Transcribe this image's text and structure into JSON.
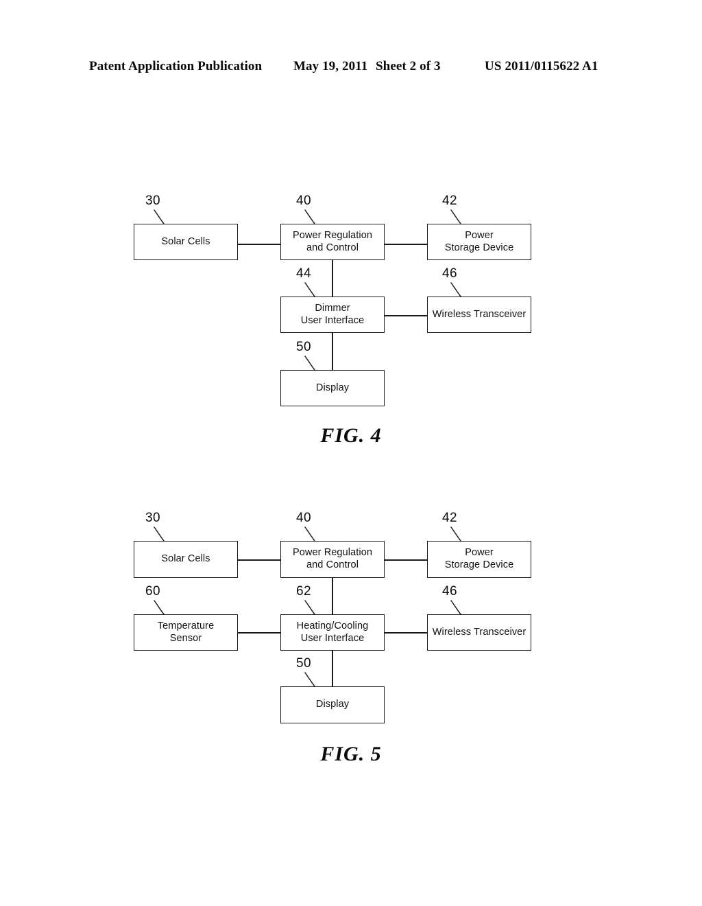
{
  "header": {
    "publication": "Patent Application Publication",
    "date": "May 19, 2011",
    "sheet": "Sheet 2 of 3",
    "patent_number": "US 2011/0115622 A1"
  },
  "figures": [
    {
      "id": "figure-4",
      "caption": "FIG. 4",
      "nodes": [
        {
          "ref": "30",
          "label": "Solar Cells"
        },
        {
          "ref": "40",
          "label": "Power Regulation\nand Control"
        },
        {
          "ref": "42",
          "label": "Power\nStorage Device"
        },
        {
          "ref": "44",
          "label": "Dimmer\nUser Interface"
        },
        {
          "ref": "46",
          "label": "Wireless Transceiver"
        },
        {
          "ref": "50",
          "label": "Display"
        }
      ]
    },
    {
      "id": "figure-5",
      "caption": "FIG. 5",
      "nodes": [
        {
          "ref": "30",
          "label": "Solar Cells"
        },
        {
          "ref": "40",
          "label": "Power Regulation\nand Control"
        },
        {
          "ref": "42",
          "label": "Power\nStorage Device"
        },
        {
          "ref": "60",
          "label": "Temperature\nSensor"
        },
        {
          "ref": "62",
          "label": "Heating/Cooling\nUser Interface"
        },
        {
          "ref": "46",
          "label": "Wireless Transceiver"
        },
        {
          "ref": "50",
          "label": "Display"
        }
      ]
    }
  ]
}
